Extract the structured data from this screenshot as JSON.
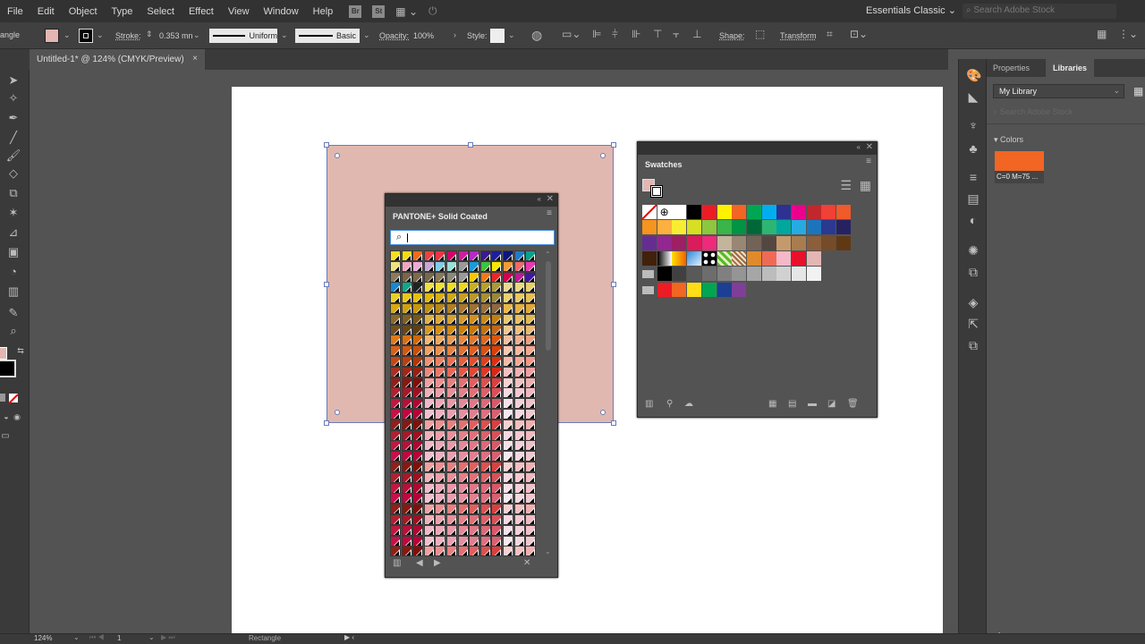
{
  "menubar": {
    "items": [
      "File",
      "Edit",
      "Object",
      "Type",
      "Select",
      "Effect",
      "View",
      "Window",
      "Help"
    ],
    "bridge_badge": "Br",
    "stock_badge": "St",
    "workspace": "Essentials Classic",
    "search_placeholder": "Search Adobe Stock"
  },
  "control": {
    "object_type": "angle",
    "fill_color": "#e3b6b3",
    "stroke_label": "Stroke:",
    "stroke_weight": "0.353 mn",
    "profile": "Uniform",
    "brush": "Basic",
    "opacity_label": "Opacity:",
    "opacity": "100%",
    "style_label": "Style:",
    "shape_label": "Shape:",
    "transform_label": "Transform"
  },
  "document": {
    "tab_title": "Untitled-1* @ 124% (CMYK/Preview)",
    "close": "×"
  },
  "swatches_panel": {
    "title": "Swatches",
    "fill_color": "#e3b6b3",
    "rows": [
      [
        "none",
        "registration",
        "#ffffff",
        "#000000",
        "#ed1c24",
        "#fff200",
        "#f26522",
        "#00a651",
        "#00aeef",
        "#2e3192",
        "#ec008c",
        "#c1272d",
        "#ef4136",
        "#f15a29"
      ],
      [
        "#f7941d",
        "#fbb040",
        "#f9ed32",
        "#d7df23",
        "#8dc63f",
        "#39b54a",
        "#009444",
        "#006838",
        "#2bb673",
        "#00a79d",
        "#27aae1",
        "#1c75bc",
        "#2b3990",
        "#262262"
      ],
      [
        "#662d91",
        "#92278f",
        "#9e1f63",
        "#da1c5c",
        "#ee2a7b",
        "#c2b59b",
        "#998675",
        "#736357",
        "#534741",
        "#c49a6c",
        "#a97c50",
        "#8b5e3c",
        "#754c29",
        "#603913"
      ],
      [
        "#42210b",
        "gradient-bw",
        "gradient-yellow",
        "gradient-blue",
        "pattern-dots",
        "pattern-leaf",
        "pattern-floral",
        "#e08a2a",
        "#ee6a55",
        "#f4b8c8",
        "#e8102a",
        "#e3b6b3"
      ],
      [
        "folder",
        "#000000",
        "#404040",
        "#595959",
        "#6d6d6d",
        "#808080",
        "#959595",
        "#a6a6a6",
        "#bcbcbc",
        "#d1d1d1",
        "#e6e6e6",
        "#f2f2f2"
      ],
      [
        "folder",
        "#ed1c24",
        "#f26522",
        "#ffde17",
        "#00a651",
        "#1c3f94",
        "#7f3f98"
      ]
    ]
  },
  "pantone_panel": {
    "title": "PANTONE+ Solid Coated",
    "search_value": "",
    "columns": 13,
    "row_colors": [
      [
        "#f5e01a",
        "#f5dc10",
        "#f26a1b",
        "#ef4040",
        "#ee3344",
        "#d4006a",
        "#cc1ea0",
        "#b62ac4",
        "#3a1a90",
        "#1a1f9c",
        "#0a1680",
        "#1f7cc8",
        "#0aa08a",
        "#222222"
      ],
      [
        "#efe27a",
        "#f3a6c0",
        "#efaad8",
        "#c8a6d8",
        "#7fcde8",
        "#98e0d8",
        "#9a9a9a",
        "#1a9bd8",
        "#3cc43c",
        "#f6e800",
        "#f59a30",
        "#ef6a6a",
        "#e838b0",
        "#d838d0"
      ],
      [
        "#8c7a5a",
        "#7a6648",
        "#806a4a",
        "#7a684a",
        "#8a7a5a",
        "#8a8a7a",
        "#9a9a9a",
        "#f2c800",
        "#f07818",
        "#e82828",
        "#d40050",
        "#c0189a",
        "#4018a0",
        "#1a24a0"
      ],
      [
        "#1888d0",
        "#10a888",
        "#222222",
        "#f0e040",
        "#f0e030",
        "#f0dc20",
        "#f0d818",
        "#c8b020",
        "#b8a028",
        "#a89a38",
        "#e8d890",
        "#ead880",
        "#e8d068",
        "#e8c850"
      ],
      [
        "#e8d020",
        "#e8c818",
        "#e4c010",
        "#e0b808",
        "#d8b010",
        "#d0a818",
        "#c8a020",
        "#b89828",
        "#a89030",
        "#988838",
        "#ead070",
        "#e8c860",
        "#e6c050",
        "#e4b840"
      ],
      [
        "#d8a810",
        "#d0a010",
        "#c89808",
        "#c09010",
        "#b88818",
        "#b08020",
        "#a87828",
        "#a07030",
        "#987038",
        "#906840",
        "#e8b848",
        "#e4b040",
        "#e0a838",
        "#dca030"
      ],
      [
        "#8a6828",
        "#806020",
        "#785818",
        "#e0b040",
        "#dca838",
        "#d8a030",
        "#d49828",
        "#d09020",
        "#c88818",
        "#c08010",
        "#e8c870",
        "#e4c060",
        "#e0b850",
        "#dcb040"
      ],
      [
        "#705020",
        "#684818",
        "#604010",
        "#d89820",
        "#d49018",
        "#d08810",
        "#cc8008",
        "#c87808",
        "#c47010",
        "#c06818",
        "#f0c890",
        "#ecc080",
        "#e8b870",
        "#e4b060"
      ],
      [
        "#e07818",
        "#d87010",
        "#d06808",
        "#f0b870",
        "#eca860",
        "#e89850",
        "#e48840",
        "#e07830",
        "#dc6820",
        "#d85810",
        "#f0c0a0",
        "#ecb090",
        "#e8a080",
        "#e49070"
      ],
      [
        "#d86018",
        "#d05810",
        "#c85008",
        "#f0a060",
        "#ec9050",
        "#e88040",
        "#e47030",
        "#e06020",
        "#dc5010",
        "#d84008",
        "#f8c8b0",
        "#f4b8a0",
        "#f0a890",
        "#ec9880"
      ],
      [
        "#c04818",
        "#b84010",
        "#b03808",
        "#f09070",
        "#ec8060",
        "#e87050",
        "#e46040",
        "#e05030",
        "#dc4020",
        "#d83010",
        "#f8b8a8",
        "#f4a898",
        "#f09888",
        "#ec8878"
      ],
      [
        "#a83020",
        "#a02818",
        "#982010",
        "#f08878",
        "#ec7868",
        "#e86858",
        "#e45848",
        "#e04838",
        "#dc3828",
        "#d82818",
        "#f8c0c0",
        "#f4b0b0",
        "#f0a0a0",
        "#ec9090"
      ],
      [
        "#902018",
        "#881810",
        "#801008",
        "#f0a0a0",
        "#ec9090",
        "#e88080",
        "#e47070",
        "#e06060",
        "#dc5050",
        "#d84040",
        "#f8d0d0",
        "#f4c0c0",
        "#f0b0b0",
        "#eca0a0"
      ],
      [
        "#b02030",
        "#a81828",
        "#a01020",
        "#f0b0b8",
        "#eca0a8",
        "#e89098",
        "#e48088",
        "#e07078",
        "#dc6068",
        "#d85058",
        "#f8d8e0",
        "#f4c8d0",
        "#f0b8c0",
        "#eca8b0"
      ],
      [
        "#c01840",
        "#b81038",
        "#b00830",
        "#f0b8c8",
        "#eca8b8",
        "#e898a8",
        "#e48898",
        "#e07888",
        "#dc6878",
        "#d85868",
        "#f8e0e8",
        "#f4d0d8",
        "#f0c0c8",
        "#ecb0b8"
      ],
      [
        "#c81048",
        "#c00840",
        "#b80038",
        "#f0c0d0",
        "#ecb0c0",
        "#e8a0b0",
        "#e490a0",
        "#e08090",
        "#dc7080",
        "#d86070",
        "#f8e8f0",
        "#f4d8e0",
        "#f0c8d0",
        "#ecb8c0"
      ]
    ]
  },
  "libraries_panel": {
    "tabs": [
      "Properties",
      "Libraries"
    ],
    "active_tab": "Libraries",
    "library": "My Library",
    "search_placeholder": "Search Adobe Stock",
    "section": "Colors",
    "color_swatch": "#f26522",
    "color_label": "C=0 M=75 ..."
  },
  "status": {
    "zoom": "124%",
    "artboard": "1",
    "tool_name": "Rectangle"
  }
}
